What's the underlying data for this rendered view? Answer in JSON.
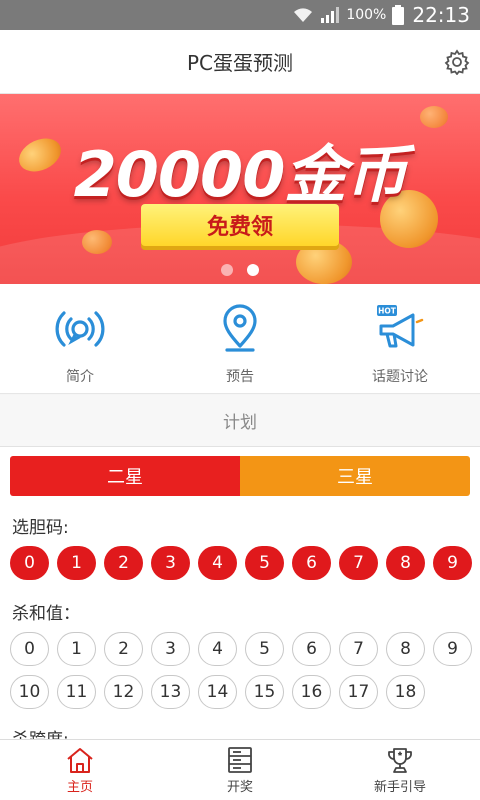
{
  "status_bar": {
    "battery": "100%",
    "time": "22:13"
  },
  "header": {
    "title": "PC蛋蛋预测",
    "settings_icon": "gear-icon"
  },
  "banner": {
    "headline": "20000金币",
    "button_label": "免费领",
    "carousel_total": 2,
    "carousel_active": 2
  },
  "quick_nav": [
    {
      "label": "简介",
      "icon": "broadcast-icon"
    },
    {
      "label": "预告",
      "icon": "location-pin-icon"
    },
    {
      "label": "话题讨论",
      "icon": "megaphone-hot-icon",
      "badge": "HOT"
    }
  ],
  "section": {
    "title": "计划"
  },
  "tabs": [
    {
      "label": "二星",
      "color": "#e8201f",
      "selected": true
    },
    {
      "label": "三星",
      "color": "#f39515",
      "selected": false
    }
  ],
  "pick_code": {
    "label": "选胆码:",
    "balls": [
      "0",
      "1",
      "2",
      "3",
      "4",
      "5",
      "6",
      "7",
      "8",
      "9"
    ]
  },
  "kill_sum": {
    "label": "杀和值：",
    "row1": [
      "0",
      "1",
      "2",
      "3",
      "4",
      "5",
      "6",
      "7",
      "8",
      "9"
    ],
    "row2": [
      "10",
      "11",
      "12",
      "13",
      "14",
      "15",
      "16",
      "17",
      "18"
    ]
  },
  "cut_off_label": "杀跨度:",
  "bottom_nav": [
    {
      "label": "主页",
      "icon": "home-icon",
      "active": true
    },
    {
      "label": "开奖",
      "icon": "server-list-icon",
      "active": false
    },
    {
      "label": "新手引导",
      "icon": "trophy-icon",
      "active": false
    }
  ],
  "colors": {
    "accent_red": "#e0191c",
    "accent_orange": "#f39515",
    "banner_red": "#fa4a4a",
    "icon_blue": "#2b8ed8"
  }
}
